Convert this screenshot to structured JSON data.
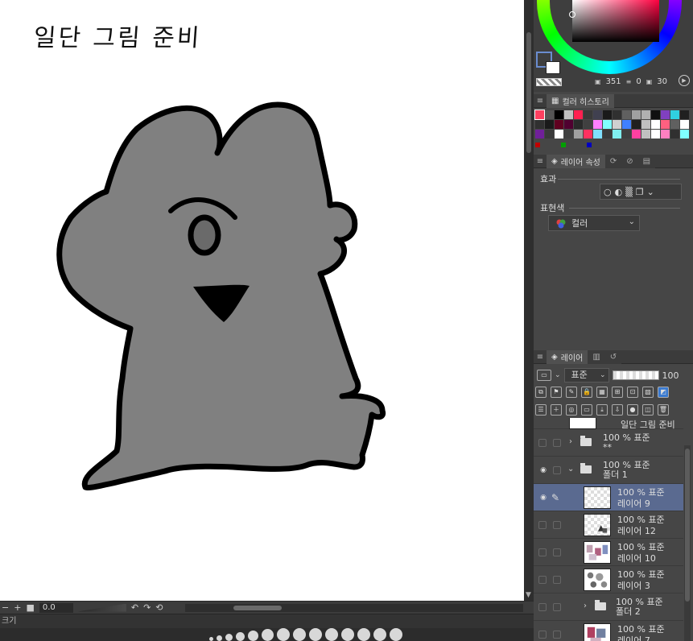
{
  "canvas": {
    "caption": "일단 그림 준비"
  },
  "bottom_bar": {
    "zoom_value": "0.0",
    "tab_fragment": "크기"
  },
  "color_wheel": {
    "readout_size": "351",
    "readout_zero": "0",
    "readout_thirty": "30"
  },
  "history_panel": {
    "title": "컬러 히스토리",
    "colors": [
      "#ff4060",
      "#555555",
      "#000000",
      "#c0c0c0",
      "#ff2050",
      "#3a3a3a",
      "#404050",
      "#1a1a1a",
      "#303030",
      "#606060",
      "#a0a0a0",
      "#b0b0b0",
      "#101010",
      "#8040c0",
      "#30d0e0",
      "#202020",
      "#303030",
      "#1a1a1a",
      "#600020",
      "#500030",
      "#2a2a2a",
      "#404040",
      "#ff80ff",
      "#80ffff",
      "#d0d0d0",
      "#4080ff",
      "#202020",
      "#c0c0c0",
      "#ffffff",
      "#ff6080",
      "#606060",
      "#ffffff",
      "#70209a",
      "#3a3a3a",
      "#ffffff",
      "#404040",
      "#a0a0a0",
      "#ff3060",
      "#80e0ff",
      "#3a3a3a",
      "#80f0f0",
      "#404040",
      "#ff40a0",
      "#c0c0c0",
      "#ffffff",
      "#ff80c0",
      "#303030",
      "#80ffff"
    ],
    "marks": [
      "#c00000",
      "#00a000",
      "#0000c0"
    ]
  },
  "layer_properties": {
    "title": "레이어 속성",
    "effect_label": "효과",
    "expression_label": "표현색",
    "expression_value": "컬러"
  },
  "layer_panel": {
    "title": "레이어",
    "blend_mode": "표준",
    "opacity": "100",
    "partial_top_label": "일단 그림 준비",
    "layers": [
      {
        "line1": "100 % 표준",
        "line2": "**",
        "type": "folder",
        "expanded": false
      },
      {
        "line1": "100 % 표준",
        "line2": "폴더 1",
        "type": "folder",
        "expanded": true
      },
      {
        "line1": "100 % 표준",
        "line2": "레이어 9",
        "type": "layer",
        "selected": true
      },
      {
        "line1": "100 % 표준",
        "line2": "레이어 12",
        "type": "layer"
      },
      {
        "line1": "100 % 표준",
        "line2": "레이어 10",
        "type": "layer"
      },
      {
        "line1": "100 % 표준",
        "line2": "레이어 3",
        "type": "layer"
      },
      {
        "line1": "100 % 표준",
        "line2": "폴더 2",
        "type": "folder",
        "expanded": false
      },
      {
        "line1": "100 % 표준",
        "line2": "레이어 7",
        "type": "layer"
      }
    ]
  },
  "icons": {
    "eye": "eye-icon",
    "pen": "pen-icon",
    "folder": "folder-icon",
    "menu": "hamburger-menu-icon",
    "play": "play-icon"
  }
}
